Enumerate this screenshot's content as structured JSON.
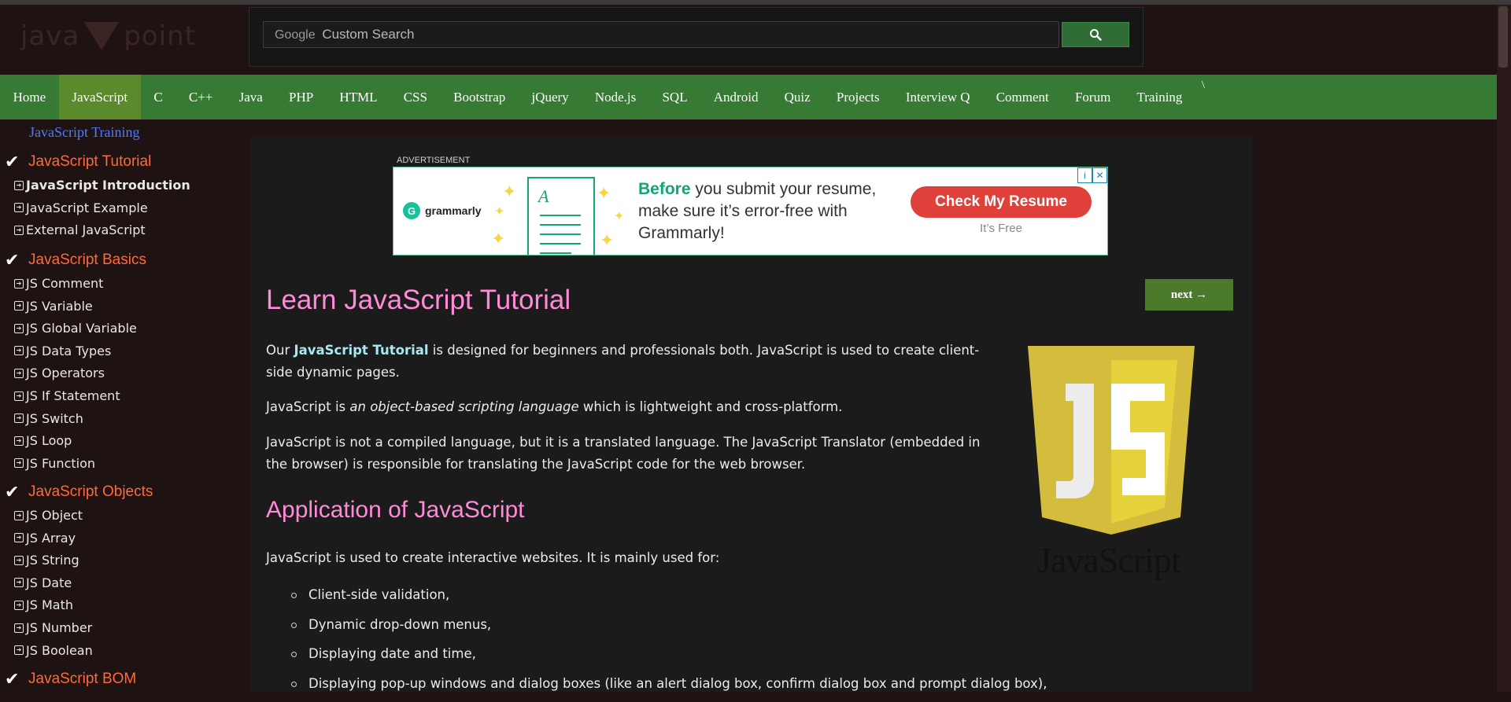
{
  "header": {
    "logo_text": [
      "java",
      "point"
    ],
    "search_placeholder_brand": "Google",
    "search_placeholder": "Custom Search",
    "search_button_icon": "search-icon"
  },
  "nav": {
    "items": [
      {
        "label": "Home"
      },
      {
        "label": "JavaScript",
        "active": true
      },
      {
        "label": "C"
      },
      {
        "label": "C++"
      },
      {
        "label": "Java"
      },
      {
        "label": "PHP"
      },
      {
        "label": "HTML"
      },
      {
        "label": "CSS"
      },
      {
        "label": "Bootstrap"
      },
      {
        "label": "jQuery"
      },
      {
        "label": "Node.js"
      },
      {
        "label": "SQL"
      },
      {
        "label": "Android"
      },
      {
        "label": "Quiz"
      },
      {
        "label": "Projects"
      },
      {
        "label": "Interview Q"
      },
      {
        "label": "Comment"
      },
      {
        "label": "Forum"
      },
      {
        "label": "Training"
      }
    ],
    "trailing": "\\"
  },
  "sidebar": {
    "training_link": "JavaScript Training",
    "groups": [
      {
        "title": "JavaScript Tutorial",
        "items": [
          "JavaScript Introduction",
          "JavaScript Example",
          "External JavaScript"
        ]
      },
      {
        "title": "JavaScript Basics",
        "items": [
          "JS Comment",
          "JS Variable",
          "JS Global Variable",
          "JS Data Types",
          "JS Operators",
          "JS If Statement",
          "JS Switch",
          "JS Loop",
          "JS Function"
        ]
      },
      {
        "title": "JavaScript Objects",
        "items": [
          "JS Object",
          "JS Array",
          "JS String",
          "JS Date",
          "JS Math",
          "JS Number",
          "JS Boolean"
        ]
      },
      {
        "title": "JavaScript BOM",
        "items": []
      }
    ]
  },
  "ad": {
    "label": "ADVERTISEMENT",
    "brand": "grammarly",
    "msg_highlight": "Before",
    "msg_rest": " you submit your resume, make sure it’s error-free with Grammarly!",
    "cta": "Check My Resume",
    "sub": "It’s Free"
  },
  "content": {
    "next_label": "next →",
    "title": "Learn JavaScript Tutorial",
    "p1_before": "Our ",
    "p1_bold": "JavaScript Tutorial",
    "p1_after": " is designed for beginners and professionals both. JavaScript is used to create client-side dynamic pages.",
    "p2_before": "JavaScript is ",
    "p2_italic": "an object-based scripting language",
    "p2_after": " which is lightweight and cross-platform.",
    "p3": "JavaScript is not a compiled language, but it is a translated language. The JavaScript Translator (embedded in the browser) is responsible for translating the JavaScript code for the web browser.",
    "h2": "Application of JavaScript",
    "p4": "JavaScript is used to create interactive websites. It is mainly used for:",
    "bullets": [
      "Client-side validation,",
      "Dynamic drop-down menus,",
      "Displaying date and time,",
      "Displaying pop-up windows and dialog boxes (like an alert dialog box, confirm dialog box and prompt dialog box),"
    ],
    "logo_letters": "JS",
    "logo_word": "JavaScript"
  }
}
